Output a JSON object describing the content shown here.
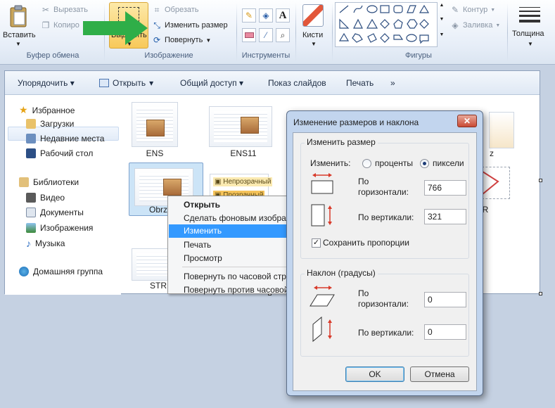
{
  "ribbon": {
    "clipboard": {
      "paste": "Вставить",
      "cut": "Вырезать",
      "copy": "Копиро",
      "group": "Буфер обмена"
    },
    "image": {
      "select": "Выделить",
      "crop": "Обрезать",
      "resize": "Изменить размер",
      "rotate": "Повернуть",
      "group": "Изображение"
    },
    "tools": {
      "group": "Инструменты"
    },
    "brushes": {
      "label": "Кисти"
    },
    "shapes": {
      "outline": "Контур",
      "fill": "Заливка",
      "group": "Фигуры"
    },
    "size": {
      "label": "Толщина"
    }
  },
  "explorer": {
    "toolbar": {
      "organize": "Упорядочить",
      "open": "Открыть",
      "share": "Общий доступ",
      "slideshow": "Показ слайдов",
      "print": "Печать",
      "more": "»"
    },
    "nav": {
      "favorites": "Избранное",
      "downloads": "Загрузки",
      "recent": "Недавние места",
      "desktop": "Рабочий стол",
      "libraries": "Библиотеки",
      "video": "Видео",
      "documents": "Документы",
      "images": "Изображения",
      "music": "Музыка",
      "homegroup": "Домашняя группа"
    },
    "files": {
      "ens": "ENS",
      "ens11": "ENS11",
      "obrz": "Obrz",
      "str": "STR",
      "opaque": "Непрозрачный",
      "transparent": "Прозрачный",
      "partial_r": "R",
      "partial_z": "z"
    }
  },
  "context_menu": {
    "items": [
      "Открыть",
      "Сделать фоновым изобра",
      "Изменить",
      "Печать",
      "Просмотр",
      "Повернуть по часовой стр",
      "Повернуть против часовой"
    ]
  },
  "dialog": {
    "title": "Изменение размеров и наклона",
    "close": "✕",
    "resize": {
      "legend": "Изменить размер",
      "by_label": "Изменить:",
      "percent": "проценты",
      "pixels": "пиксели",
      "horizontal_l1": "По",
      "horizontal_l2": "горизонтали:",
      "horizontal_value": "766",
      "vertical_label": "По вертикали:",
      "vertical_value": "321",
      "keep_ratio": "Сохранить пропорции"
    },
    "skew": {
      "legend": "Наклон (градусы)",
      "horizontal_l1": "По",
      "horizontal_l2": "горизонтали:",
      "horizontal_value": "0",
      "vertical_label": "По вертикали:",
      "vertical_value": "0"
    },
    "ok": "OK",
    "cancel": "Отмена"
  },
  "colors": {
    "accent_arrow": "#2fae48",
    "menu_highlight": "#3399ff",
    "selected_button": "#fbd57a"
  }
}
